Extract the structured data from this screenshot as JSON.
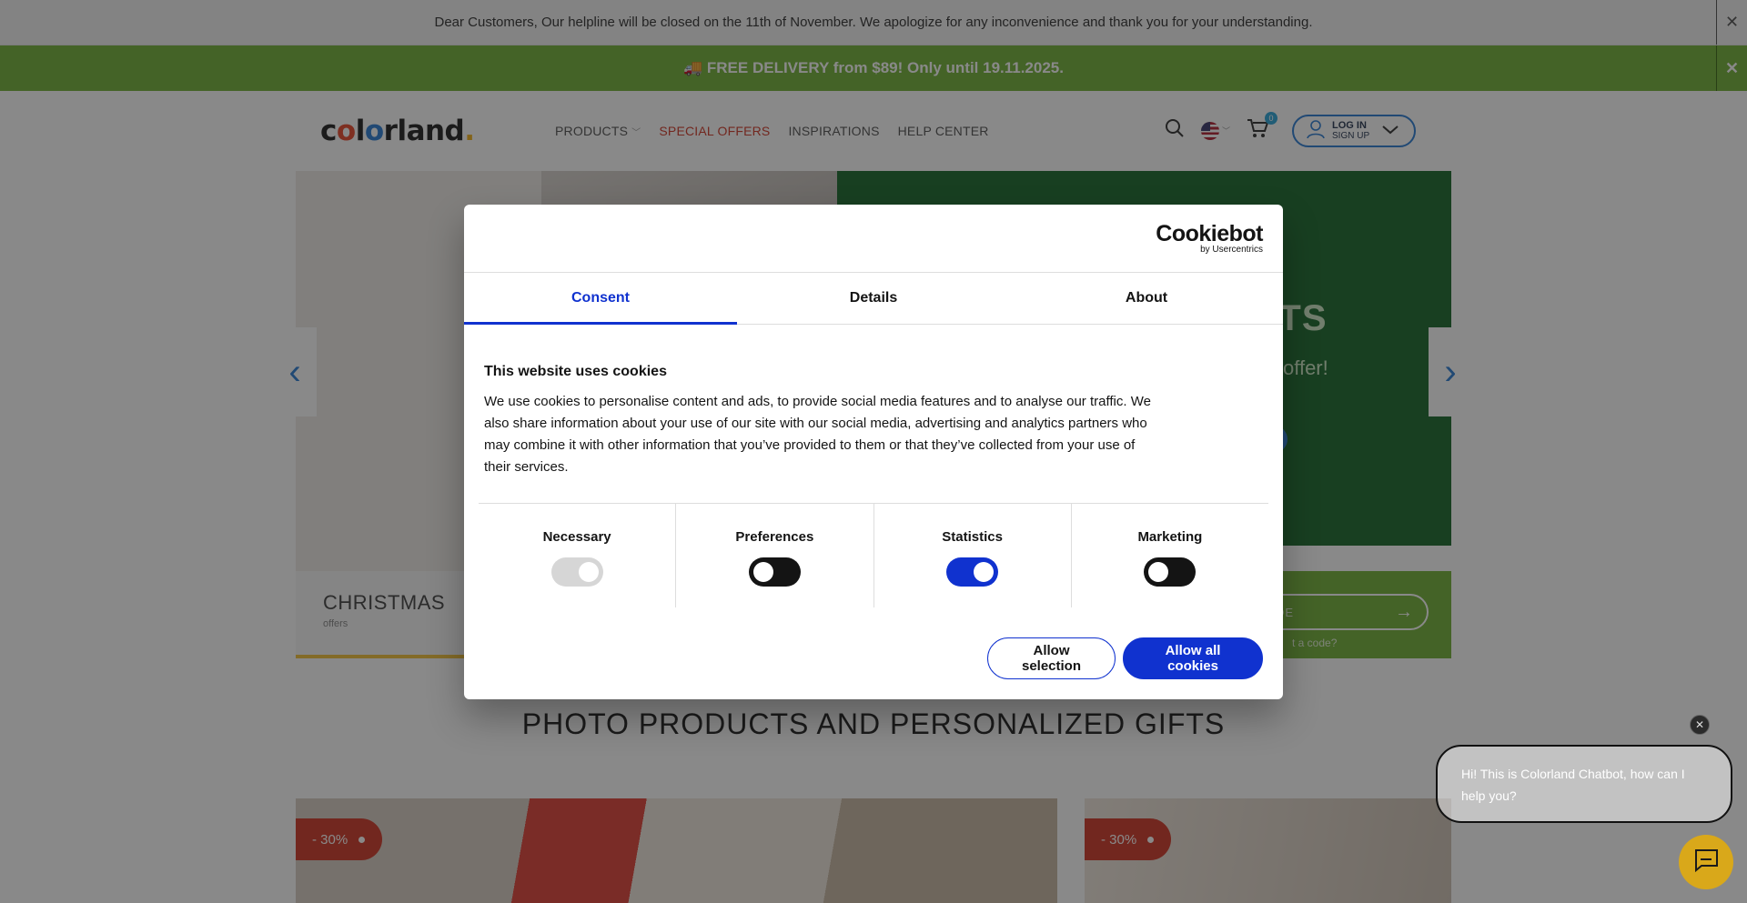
{
  "notice": {
    "text": "Dear Customers, Our helpline will be closed on the 11th of November. We apologize for any inconvenience and thank you for your understanding.",
    "close": "✕"
  },
  "promo": {
    "text": "🚚 FREE DELIVERY from $89! Only until 19.11.2025.",
    "close": "✕"
  },
  "header": {
    "logo": {
      "c": "c",
      "o1": "o",
      "l": "l",
      "o2": "o",
      "rland": "rland",
      "dot": "."
    },
    "nav": [
      {
        "label": "PRODUCTS",
        "has_chevron": true
      },
      {
        "label": "SPECIAL OFFERS",
        "highlight": true
      },
      {
        "label": "INSPIRATIONS"
      },
      {
        "label": "HELP CENTER"
      }
    ],
    "cart_count": "0",
    "login": {
      "line1": "LOG IN",
      "line2": "SIGN UP"
    }
  },
  "hero": {
    "right_heading": "FTS",
    "right_sub": "offer!",
    "left_title": "CHRISTMAS",
    "left_sub": "offers",
    "code_placeholder": "DE",
    "code_help": "t a code?",
    "prev_arrow": "‹",
    "next_arrow": "›"
  },
  "section_title": "PHOTO PRODUCTS AND PERSONALIZED GIFTS",
  "tiles": [
    {
      "discount": "- 30%"
    },
    {
      "discount": "- 30%"
    }
  ],
  "cookie": {
    "logo_name": "Cookiebot",
    "logo_by": "by Usercentrics",
    "tabs": [
      "Consent",
      "Details",
      "About"
    ],
    "active_tab": "Consent",
    "heading": "This website uses cookies",
    "body": "We use cookies to personalise content and ads, to provide social media features and to analyse our traffic. We also share information about your use of our site with our social media, advertising and analytics partners who may combine it with other information that you’ve provided to them or that they’ve collected from your use of their services.",
    "categories": [
      {
        "label": "Necessary",
        "state": "on",
        "disabled": true
      },
      {
        "label": "Preferences",
        "state": "off"
      },
      {
        "label": "Statistics",
        "state": "on"
      },
      {
        "label": "Marketing",
        "state": "off"
      }
    ],
    "buttons": {
      "allow_selection": "Allow selection",
      "allow_all": "Allow all cookies"
    },
    "colors": {
      "accent": "#1032cf",
      "text": "#141414"
    }
  },
  "chatbot": {
    "message": "Hi! This is Colorland Chatbot, how can I help you?",
    "close": "✕"
  }
}
